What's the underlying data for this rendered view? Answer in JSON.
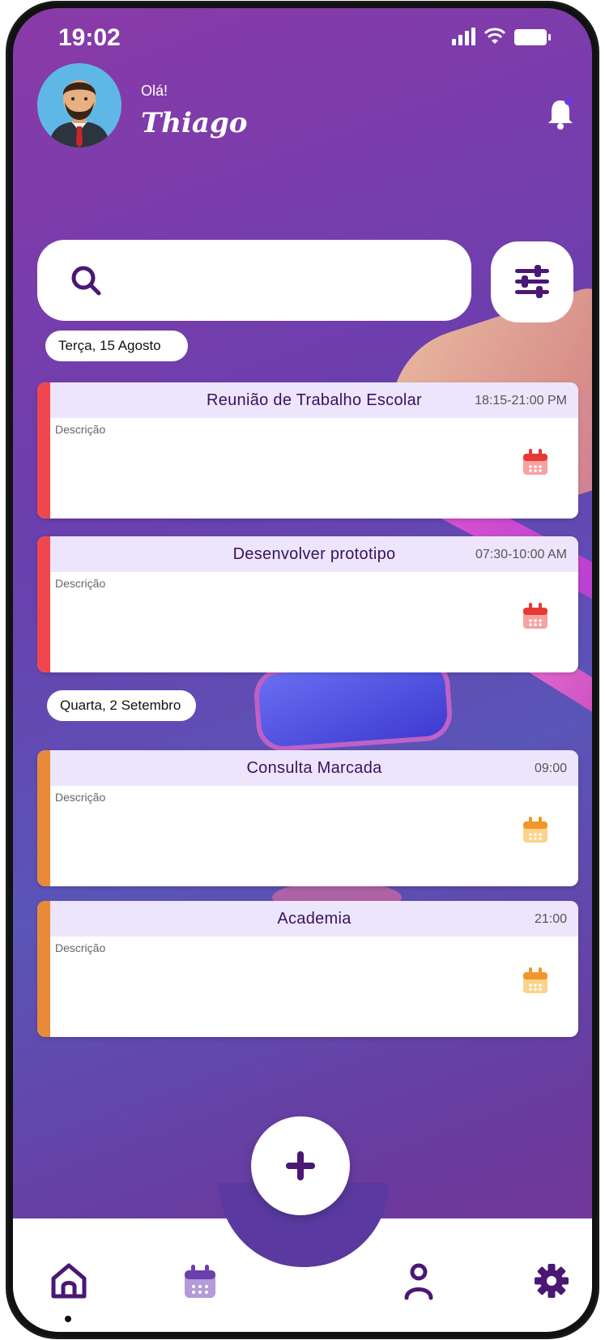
{
  "status_bar": {
    "time": "19:02"
  },
  "header": {
    "greeting": "Olá!",
    "user_name": "Thiago"
  },
  "search": {
    "placeholder": ""
  },
  "groups": [
    {
      "date_label": "Terça, 15 Agosto",
      "events": [
        {
          "title": "Reunião de Trabalho Escolar",
          "time": "18:15-21:00 PM",
          "description": "Descrição",
          "accent": "#f0474e"
        },
        {
          "title": "Desenvolver prototipo",
          "time": "07:30-10:00 AM",
          "description": "Descrição",
          "accent": "#f0474e"
        }
      ]
    },
    {
      "date_label": "Quarta, 2 Setembro",
      "events": [
        {
          "title": "Consulta Marcada",
          "time": "09:00",
          "description": "Descrição",
          "accent": "#e98a3a"
        },
        {
          "title": "Academia",
          "time": "21:00",
          "description": "Descrição",
          "accent": "#e98a3a"
        }
      ]
    }
  ],
  "icons": {
    "search": "search-icon",
    "filter": "sliders-icon",
    "bell": "bell-icon",
    "event": "calendar-icon",
    "add": "plus-icon",
    "nav": [
      "home-icon",
      "calendar-icon",
      "user-icon",
      "gear-icon"
    ]
  },
  "colors": {
    "primary": "#4a1775",
    "accent_red": "#f0474e",
    "accent_orange": "#e98a3a",
    "card_header": "#ece5fb"
  }
}
